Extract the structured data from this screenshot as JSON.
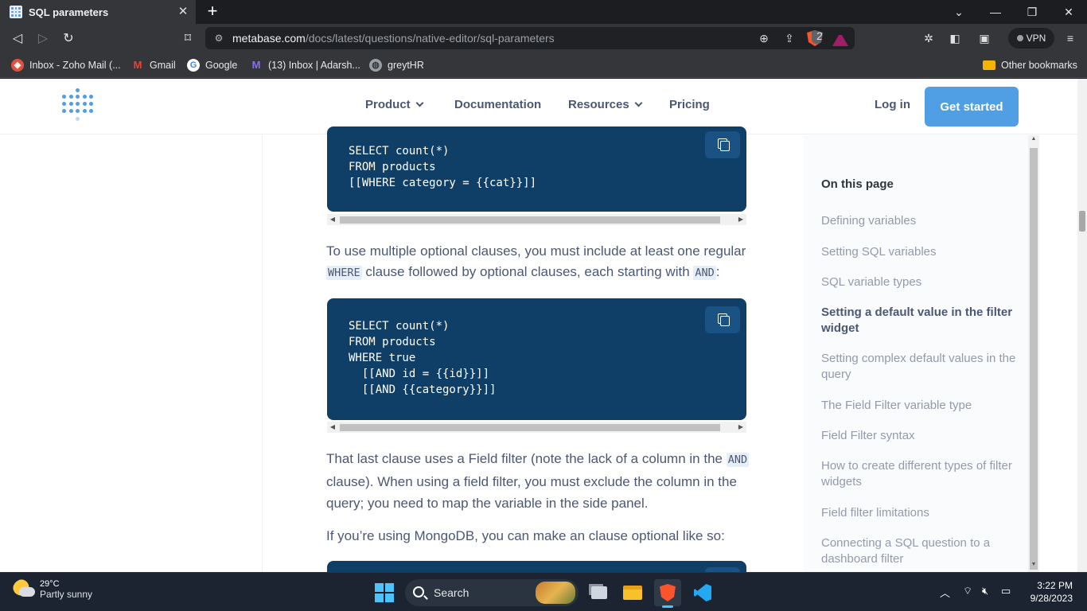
{
  "browser": {
    "tab_title": "SQL parameters",
    "new_tab": "+",
    "url_host": "metabase.com",
    "url_path": "/docs/latest/questions/native-editor/sql-parameters",
    "shield_count": "2",
    "vpn_label": "VPN",
    "bookmarks": [
      {
        "label": "Inbox - Zoho Mail (...",
        "icon": "zoho-mail-icon"
      },
      {
        "label": "Gmail",
        "icon": "gmail-icon"
      },
      {
        "label": "Google",
        "icon": "google-icon"
      },
      {
        "label": "(13) Inbox | Adarsh...",
        "icon": "proton-mail-icon"
      },
      {
        "label": "greytHR",
        "icon": "greythr-icon"
      }
    ],
    "other_bookmarks": "Other bookmarks"
  },
  "site_header": {
    "nav": [
      "Product",
      "Documentation",
      "Resources",
      "Pricing"
    ],
    "login": "Log in",
    "cta": "Get started"
  },
  "content": {
    "code1": "SELECT count(*)\nFROM products\n[[WHERE category = {{cat}}]]",
    "para1_a": "To use multiple optional clauses, you must include at least one regular ",
    "para1_code1": "WHERE",
    "para1_b": " clause followed by optional clauses, each starting with ",
    "para1_code2": "AND",
    "para1_c": ":",
    "code2": "SELECT count(*)\nFROM products\nWHERE true\n  [[AND id = {{id}}]]\n  [[AND {{category}}]]",
    "para2_a": "That last clause uses a Field filter (note the lack of a column in the ",
    "para2_code": "AND",
    "para2_b": " clause). When using a field filter, you must exclude the column in the query; you need to map the variable in the side panel.",
    "para3": "If you’re using MongoDB, you can make an clause optional like so:"
  },
  "toc": {
    "heading": "On this page",
    "items": [
      "Defining variables",
      "Setting SQL variables",
      "SQL variable types",
      "Setting a default value in the filter widget",
      "Setting complex default values in the query",
      "The Field Filter variable type",
      "Field Filter syntax",
      "How to create different types of filter widgets",
      "Field filter limitations",
      "Connecting a SQL question to a dashboard filter"
    ],
    "active_index": 3
  },
  "taskbar": {
    "temp": "29°C",
    "weather": "Partly sunny",
    "search": "Search",
    "time": "3:22 PM",
    "date": "9/28/2023"
  }
}
